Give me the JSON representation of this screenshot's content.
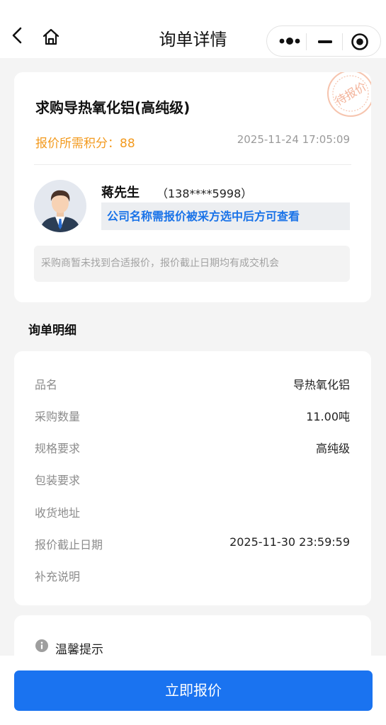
{
  "nav": {
    "title": "询单详情"
  },
  "request": {
    "title": "求购导热氧化铝(高纯级)",
    "points_label": "报价所需积分：",
    "points": "88",
    "time": "2025-11-24 17:05:09",
    "stamp": "待报价",
    "buyer": {
      "name": "蒋先生",
      "phone": "（138****5998）",
      "company_note": "公司名称需报价被采方选中后方可查看"
    },
    "notice": "采购商暂未找到合适报价，报价截止日期均有成交机会"
  },
  "detail": {
    "section_title": "询单明细",
    "rows": [
      {
        "label": "品名",
        "value": "导热氧化铝"
      },
      {
        "label": "采购数量",
        "value": "11.00吨"
      },
      {
        "label": "规格要求",
        "value": "高纯级"
      },
      {
        "label": "包装要求",
        "value": ""
      },
      {
        "label": "收货地址",
        "value": ""
      },
      {
        "label": "报价截止日期",
        "value": "2025-11-30 23:59:59"
      },
      {
        "label": "补充说明",
        "value": ""
      }
    ]
  },
  "tips": {
    "label": "温馨提示"
  },
  "cta": {
    "label": "立即报价"
  },
  "colors": {
    "accent": "#1a73f0",
    "points": "#f39a1e",
    "stamp": "#f3b39a"
  }
}
